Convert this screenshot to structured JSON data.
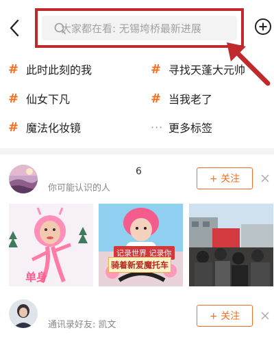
{
  "header": {
    "search_placeholder": "大家都在看: 无锡垮桥最新进展"
  },
  "tags": [
    {
      "label": "此时此刻的我"
    },
    {
      "label": "寻找天蓬大元帅"
    },
    {
      "label": "仙女下凡"
    },
    {
      "label": "当我老了"
    },
    {
      "label": "魔法化妆镜"
    },
    {
      "label": "更多标签"
    }
  ],
  "recommendations": [
    {
      "name": "6",
      "subtitle": "你可能认识的人",
      "follow_label": "+ 关注",
      "thumbnails": [
        {
          "caption": "单身"
        },
        {
          "ribbon": "记录世界 记录你",
          "caption": "骑着新爱魔托车"
        },
        {
          "caption": ""
        }
      ]
    },
    {
      "name": "",
      "subtitle": "通讯录好友: 凯文",
      "follow_label": "+ 关注"
    }
  ],
  "colors": {
    "accent": "#f36d1f",
    "annotation_red": "#c0292e",
    "divider": "#f4f4f4"
  },
  "icons": {
    "back": "chevron-left-icon",
    "search": "search-icon",
    "add": "add-circle-icon",
    "close": "close-icon",
    "tag": "hash-icon",
    "more": "ellipsis-icon"
  }
}
